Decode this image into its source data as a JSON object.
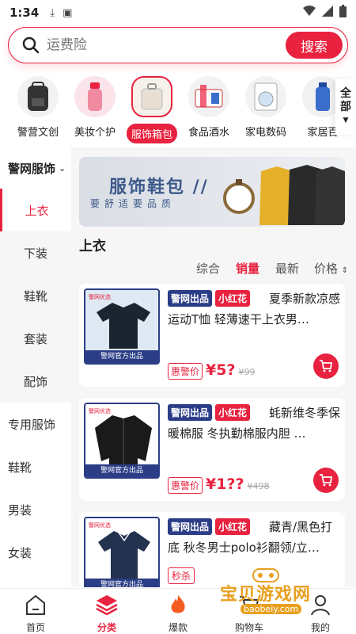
{
  "status": {
    "time": "1:34"
  },
  "search": {
    "placeholder": "运费险",
    "button": "搜索"
  },
  "categories": [
    {
      "label": "警营文创"
    },
    {
      "label": "美妆个护"
    },
    {
      "label": "服饰箱包"
    },
    {
      "label": "食品酒水"
    },
    {
      "label": "家电数码"
    },
    {
      "label": "家居百"
    }
  ],
  "all_categories": "全部",
  "sidebar": {
    "top": "警网服饰",
    "sub_items": [
      "上衣",
      "下装",
      "鞋靴",
      "套装",
      "配饰"
    ],
    "groups": [
      "专用服饰",
      "鞋靴",
      "男装",
      "女装"
    ]
  },
  "banner": {
    "title": "服饰鞋包 //",
    "subtitle": "要舒适要品质"
  },
  "section_title": "上衣",
  "sort": {
    "comprehensive": "综合",
    "sales": "销量",
    "newest": "最新",
    "price": "价格"
  },
  "products": [
    {
      "badge1": "警网出品",
      "badge2": "小红花",
      "title": "夏季新款凉感运动T恤 轻薄速干上衣男…",
      "price_tag": "惠警价",
      "price": "¥5?",
      "orig_price": "¥99",
      "img_strip": "警网官方出品",
      "img_tag": "警网优选"
    },
    {
      "badge1": "警网出品",
      "badge2": "小红花",
      "title": "蚝新维冬季保暖棉服 冬执勤棉服内胆 …",
      "price_tag": "惠警价",
      "price": "¥1??",
      "orig_price": "¥498",
      "img_strip": "警网官方出品",
      "img_tag": "警网优选"
    },
    {
      "badge1": "警网出品",
      "badge2": "小红花",
      "title": "藏青/黑色打底 秋冬男士polo衫翻领/立…",
      "tag": "秒杀",
      "img_strip": "警网官方出品",
      "img_tag": "警网优选"
    }
  ],
  "tabs": [
    {
      "label": "首页"
    },
    {
      "label": "分类"
    },
    {
      "label": "爆款"
    },
    {
      "label": "购物车"
    },
    {
      "label": "我的"
    }
  ],
  "watermark": {
    "text": "宝贝游戏网",
    "url": "baobeiy.com"
  },
  "colors": {
    "accent": "#e8223f",
    "brand_blue": "#2b3d86"
  }
}
